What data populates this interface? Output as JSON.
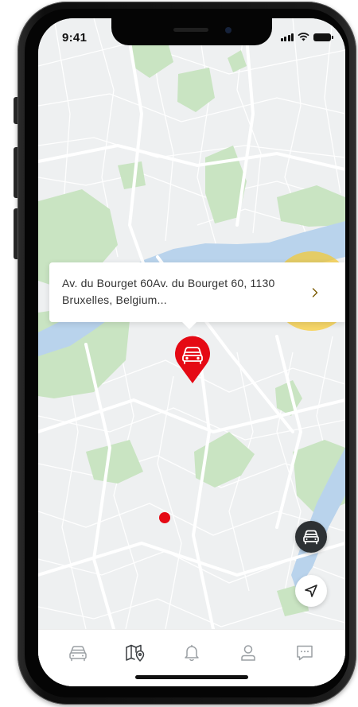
{
  "status_bar": {
    "time": "9:41"
  },
  "map": {
    "water_color": "#b9d3ec",
    "park_color": "#c9e4c2",
    "road_color": "#ffffff",
    "land_color": "#eef0f1"
  },
  "address_popup": {
    "address": "Av. du Bourget 60Av. du Bourget 60, 1130 Bruxelles, Belgium...",
    "arrow_icon": "chevron-right-icon"
  },
  "markers": {
    "car_pin_icon": "car-pin-icon",
    "car_pin_color": "#e50914",
    "location_dot_color": "#e50914"
  },
  "fabs": {
    "vehicle_icon": "car-icon",
    "locate_icon": "navigation-arrow-icon"
  },
  "bottom_nav": {
    "items": [
      {
        "id": "vehicle",
        "icon": "car-icon"
      },
      {
        "id": "map",
        "icon": "map-pin-icon",
        "active": true
      },
      {
        "id": "notifications",
        "icon": "bell-icon"
      },
      {
        "id": "profile",
        "icon": "user-icon"
      },
      {
        "id": "messages",
        "icon": "chat-icon"
      }
    ]
  },
  "highlight": {
    "color": "#fac81e"
  }
}
